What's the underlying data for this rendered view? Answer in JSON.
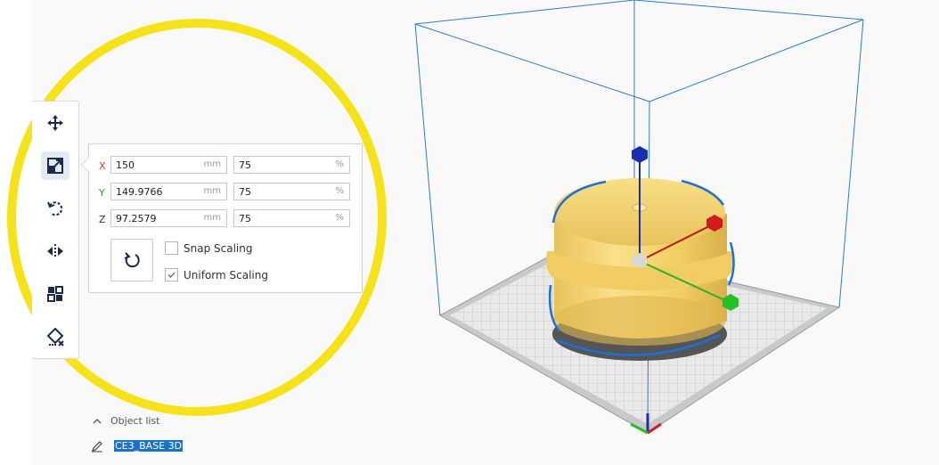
{
  "toolbar": {
    "tools": [
      {
        "name": "move",
        "icon": "move-icon"
      },
      {
        "name": "scale",
        "icon": "scale-icon",
        "active": true
      },
      {
        "name": "rotate",
        "icon": "rotate-icon"
      },
      {
        "name": "mirror",
        "icon": "mirror-icon"
      },
      {
        "name": "per-model-settings",
        "icon": "per-model-settings-icon"
      },
      {
        "name": "support-blocker",
        "icon": "support-blocker-icon"
      }
    ]
  },
  "scale_panel": {
    "x": {
      "axis": "X",
      "mm": "150",
      "mm_unit": "mm",
      "percent": "75",
      "percent_unit": "%",
      "color": "#e03030"
    },
    "y": {
      "axis": "Y",
      "mm": "149.9766",
      "mm_unit": "mm",
      "percent": "75",
      "percent_unit": "%",
      "color": "#2e9b2e"
    },
    "z": {
      "axis": "Z",
      "mm": "97.2579",
      "mm_unit": "mm",
      "percent": "75",
      "percent_unit": "%",
      "color": "#303030"
    },
    "snap_scaling": {
      "label": "Snap Scaling",
      "checked": false
    },
    "uniform_scaling": {
      "label": "Uniform Scaling",
      "checked": true
    }
  },
  "object_list": {
    "header": "Object list",
    "object_name": "CE3_BASE 3D"
  },
  "colors": {
    "highlight_circle": "#f5e21a",
    "model": "#f3d467",
    "selection_outline": "#1e6fd9",
    "build_volume": "#2a7ad6"
  }
}
